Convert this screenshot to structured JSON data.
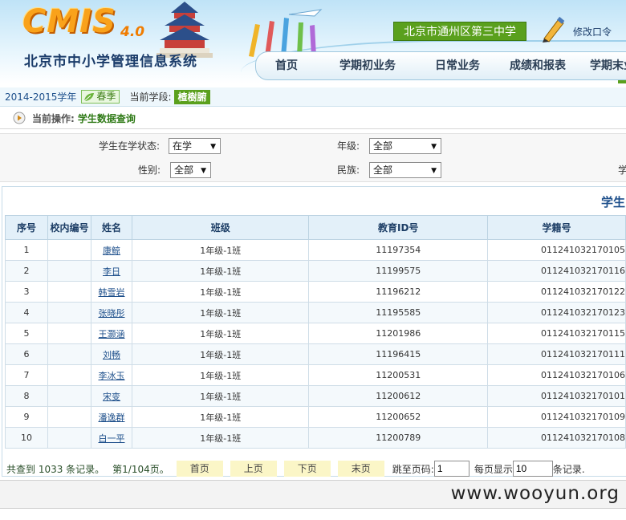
{
  "header": {
    "logo_text": "CMIS",
    "logo_version": "4.0",
    "system_title": "北京市中小学管理信息系统",
    "school_name": "北京市通州区第三中学",
    "change_password": "修改口令",
    "nav": [
      "首页",
      "学期初业务",
      "日常业务",
      "成绩和报表",
      "学期末业"
    ]
  },
  "term_bar": {
    "year": "2014-2015学年",
    "season": "春季",
    "stage_label": "当前学段:",
    "stage_value": "楂樹腑"
  },
  "operation": {
    "label": "当前操作:",
    "value": "学生数据查询"
  },
  "filters": {
    "status_label": "学生在学状态:",
    "status_value": "在学",
    "grade_label": "年级:",
    "grade_value": "全部",
    "gender_label": "性别:",
    "gender_value": "全部",
    "ethnicity_label": "民族:",
    "ethnicity_value": "全部",
    "cut_label": "学"
  },
  "results": {
    "title": "学生",
    "columns": [
      "序号",
      "校内编号",
      "姓名",
      "班级",
      "教育ID号",
      "学籍号"
    ],
    "rows": [
      {
        "no": "1",
        "school_id": "",
        "name": "康鲸",
        "class": "1年级-1班",
        "edu_id": "11197354",
        "student_id": "011241032170105"
      },
      {
        "no": "2",
        "school_id": "",
        "name": "李日",
        "class": "1年级-1班",
        "edu_id": "11199575",
        "student_id": "011241032170116"
      },
      {
        "no": "3",
        "school_id": "",
        "name": "韩雪岩",
        "class": "1年级-1班",
        "edu_id": "11196212",
        "student_id": "011241032170122"
      },
      {
        "no": "4",
        "school_id": "",
        "name": "张晓彤",
        "class": "1年级-1班",
        "edu_id": "11195585",
        "student_id": "011241032170123"
      },
      {
        "no": "5",
        "school_id": "",
        "name": "王灏涵",
        "class": "1年级-1班",
        "edu_id": "11201986",
        "student_id": "011241032170115"
      },
      {
        "no": "6",
        "school_id": "",
        "name": "刘畅",
        "class": "1年级-1班",
        "edu_id": "11196415",
        "student_id": "011241032170111"
      },
      {
        "no": "7",
        "school_id": "",
        "name": "李冰玉",
        "class": "1年级-1班",
        "edu_id": "11200531",
        "student_id": "011241032170106"
      },
      {
        "no": "8",
        "school_id": "",
        "name": "宋变",
        "class": "1年级-1班",
        "edu_id": "11200612",
        "student_id": "011241032170101"
      },
      {
        "no": "9",
        "school_id": "",
        "name": "潘逸群",
        "class": "1年级-1班",
        "edu_id": "11200652",
        "student_id": "011241032170109"
      },
      {
        "no": "10",
        "school_id": "",
        "name": "白一平",
        "class": "1年级-1班",
        "edu_id": "11200789",
        "student_id": "011241032170108"
      }
    ]
  },
  "pager": {
    "total": "共查到 1033 条记录。",
    "page_info": "第1/104页。",
    "first": "首页",
    "prev": "上页",
    "next": "下页",
    "last": "末页",
    "jump_label": "跳至页码:",
    "jump_value": "1",
    "per_page_label": "每页显示",
    "per_page_value": "10",
    "per_page_suffix": "条记录."
  },
  "watermark": "www.wooyun.org",
  "colors": {
    "accent_green": "#5aa01d",
    "link_blue": "#1d4f8b",
    "header_sky": "#bfe3f7",
    "pager_button": "#fbf6c7"
  }
}
